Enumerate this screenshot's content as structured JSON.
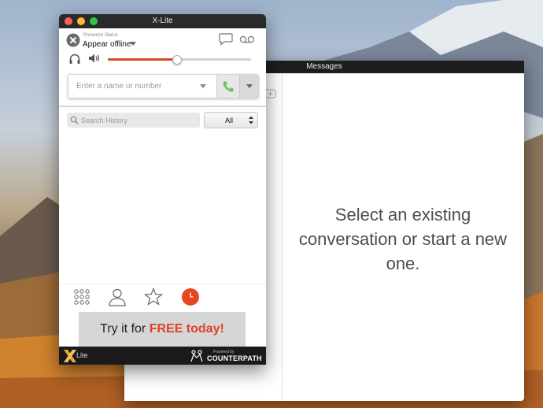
{
  "xlite": {
    "title": "X-Lite",
    "presence_label": "Presence Status",
    "presence_value": "Appear offline",
    "volume_level": 0.48,
    "dial_placeholder": "Enter a name or number",
    "search_placeholder": "Search History",
    "filter_value": "All",
    "ad_prefix": "Try it for ",
    "ad_highlight": "FREE today!",
    "logo_text": "Lite",
    "powered_by": "Powered by",
    "brand": "COUNTERPATH"
  },
  "messages": {
    "title": "Messages",
    "empty_state": "Select an existing conversation or start a new one."
  },
  "colors": {
    "accent": "#d9482b",
    "call_green": "#6fbf5b",
    "titlebar": "#2a2a2a"
  },
  "icons": [
    "presence-offline-icon",
    "chat-icon",
    "voicemail-icon",
    "headset-icon",
    "speaker-icon",
    "phone-icon",
    "search-icon",
    "dialpad-icon",
    "contacts-icon",
    "favorites-icon",
    "history-icon"
  ]
}
